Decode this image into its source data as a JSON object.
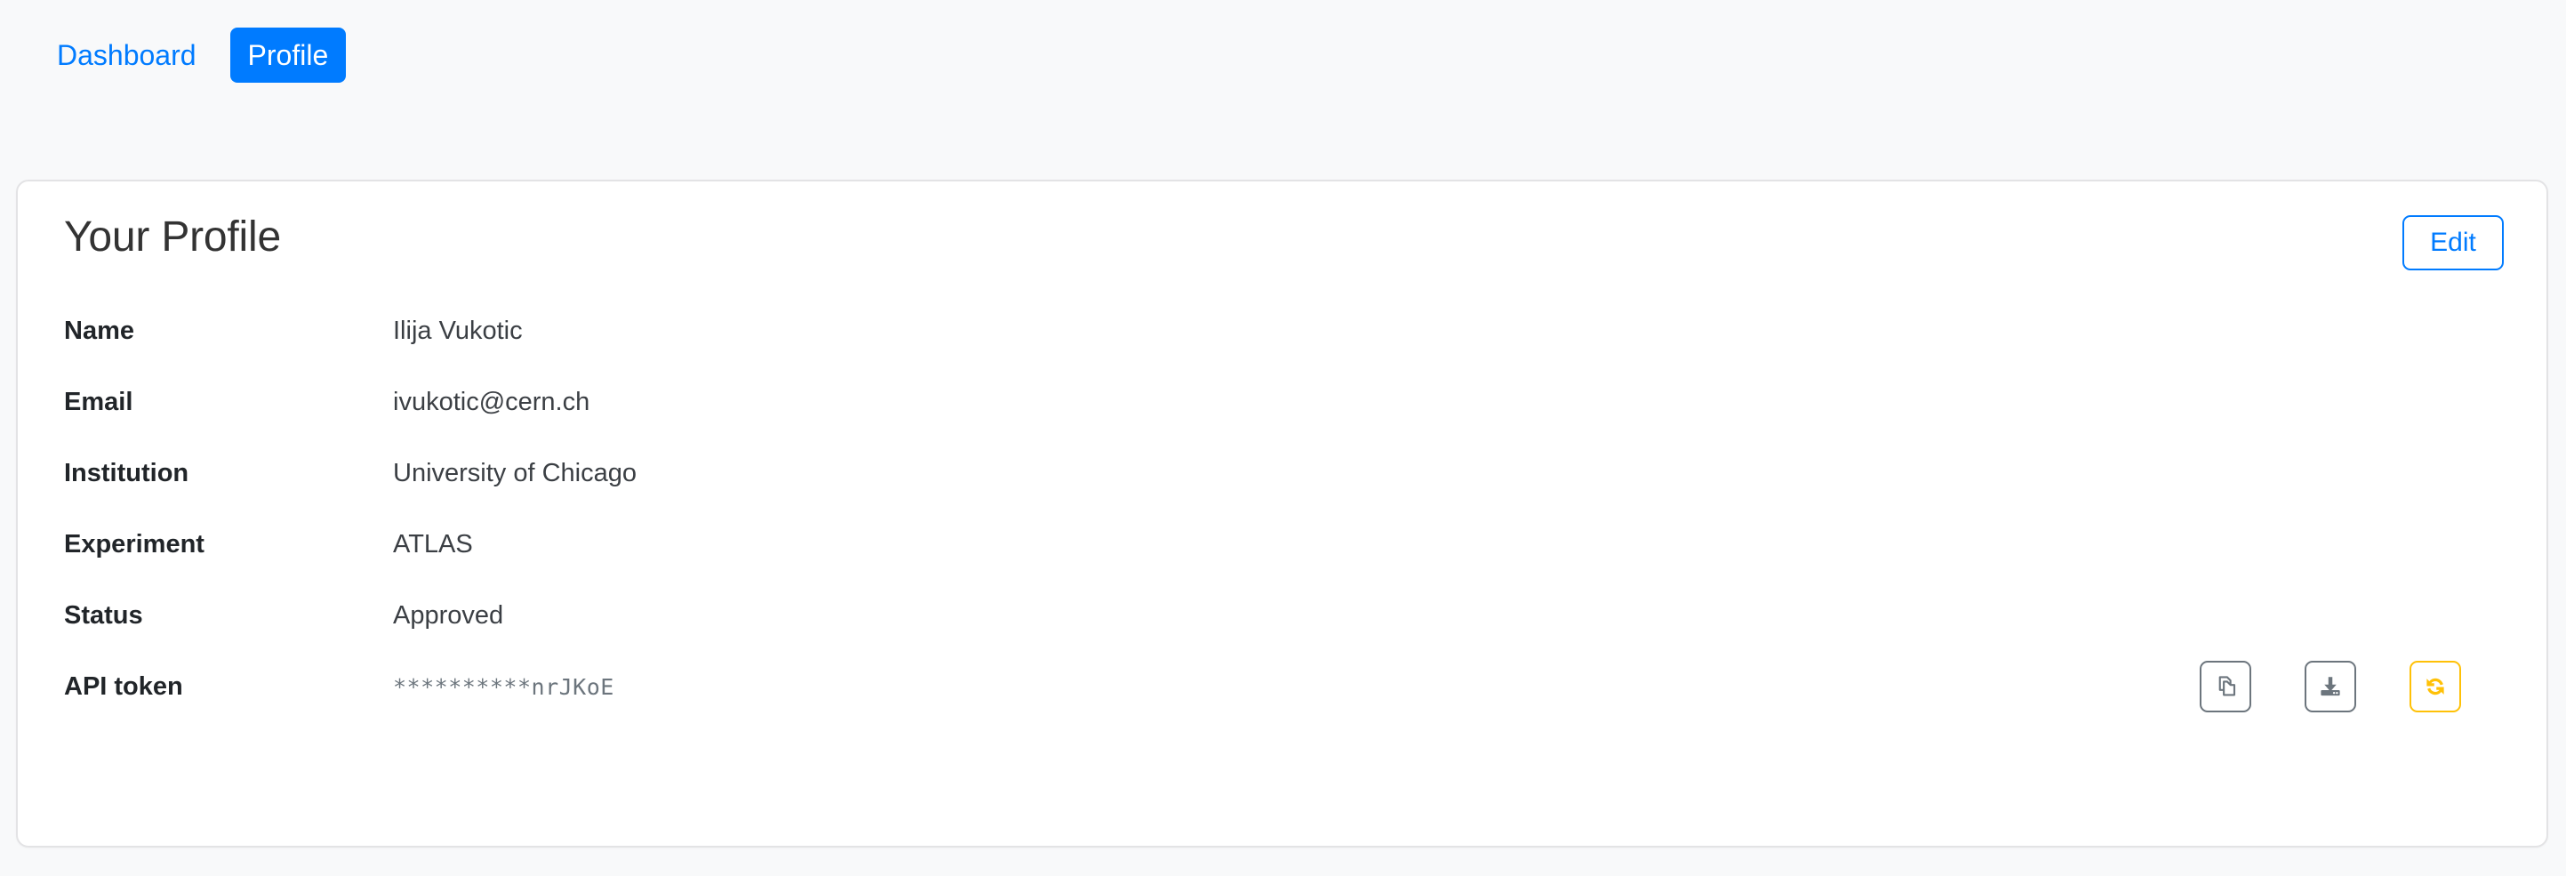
{
  "nav": {
    "items": [
      {
        "label": "Dashboard",
        "active": false,
        "name": "nav-link-dashboard"
      },
      {
        "label": "Profile",
        "active": true,
        "name": "nav-link-profile"
      }
    ]
  },
  "card": {
    "title": "Your Profile",
    "edit_label": "Edit",
    "fields": [
      {
        "label": "Name",
        "value": "Ilija Vukotic"
      },
      {
        "label": "Email",
        "value": "ivukotic@cern.ch"
      },
      {
        "label": "Institution",
        "value": "University of Chicago"
      },
      {
        "label": "Experiment",
        "value": "ATLAS"
      },
      {
        "label": "Status",
        "value": "Approved"
      },
      {
        "label": "API token",
        "value": "**********nrJKoE"
      }
    ],
    "token_actions": [
      {
        "icon": "copy-icon",
        "name": "copy-token-button"
      },
      {
        "icon": "download-icon",
        "name": "download-token-button"
      },
      {
        "icon": "refresh-icon",
        "name": "regenerate-token-button"
      }
    ]
  },
  "colors": {
    "primary": "#007bff",
    "warning": "#ffc107",
    "muted": "#6c757d",
    "page_background": "#f8f9fa",
    "card_background": "#ffffff",
    "card_border": "#e3e3e5",
    "text": "#212529"
  }
}
